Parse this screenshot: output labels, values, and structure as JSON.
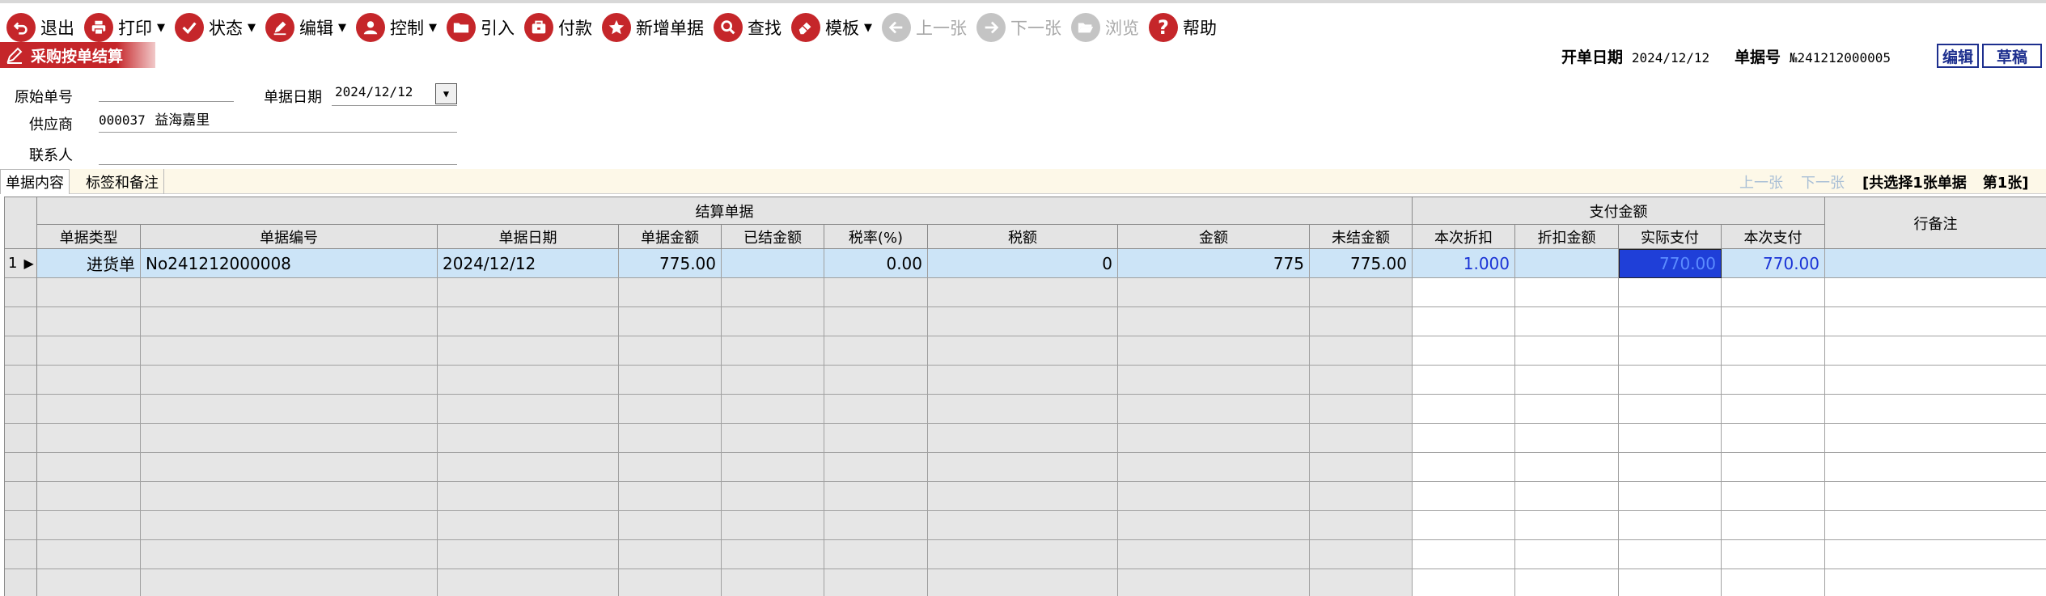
{
  "toolbar": {
    "items": [
      {
        "label": "退出",
        "icon": "exit-icon",
        "dropdown": false,
        "enabled": true
      },
      {
        "label": "打印",
        "icon": "printer-icon",
        "dropdown": true,
        "enabled": true
      },
      {
        "label": "状态",
        "icon": "check-icon",
        "dropdown": true,
        "enabled": true
      },
      {
        "label": "编辑",
        "icon": "pencil-icon",
        "dropdown": true,
        "enabled": true
      },
      {
        "label": "控制",
        "icon": "user-icon",
        "dropdown": true,
        "enabled": true
      },
      {
        "label": "引入",
        "icon": "folder-icon",
        "dropdown": false,
        "enabled": true
      },
      {
        "label": "付款",
        "icon": "briefcase-icon",
        "dropdown": false,
        "enabled": true
      },
      {
        "label": "新增单据",
        "icon": "star-icon",
        "dropdown": false,
        "enabled": true
      },
      {
        "label": "查找",
        "icon": "search-icon",
        "dropdown": false,
        "enabled": true
      },
      {
        "label": "模板",
        "icon": "eraser-icon",
        "dropdown": true,
        "enabled": true
      },
      {
        "label": "上一张",
        "icon": "arrow-left-icon",
        "dropdown": false,
        "enabled": false
      },
      {
        "label": "下一张",
        "icon": "arrow-right-icon",
        "dropdown": false,
        "enabled": false
      },
      {
        "label": "浏览",
        "icon": "folder-open-icon",
        "dropdown": false,
        "enabled": false
      },
      {
        "label": "帮助",
        "icon": "help-icon",
        "dropdown": false,
        "enabled": true
      }
    ]
  },
  "window": {
    "title": "采购按单结算"
  },
  "header": {
    "open_date_label": "开单日期",
    "open_date": "2024/12/12",
    "doc_no_label": "单据号",
    "doc_no": "№241212000005",
    "edit_label": "编辑",
    "draft_label": "草稿"
  },
  "form": {
    "orig_no_label": "原始单号",
    "orig_no": "",
    "doc_date_label": "单据日期",
    "doc_date": "2024/12/12",
    "supplier_label": "供应商",
    "supplier_code": "000037",
    "supplier_name": "益海嘉里",
    "contact_label": "联系人",
    "contact": ""
  },
  "tabs": {
    "content": "单据内容",
    "tags": "标签和备注"
  },
  "pager": {
    "prev": "上一张",
    "next": "下一张",
    "selected": "[共选择1张单据",
    "page": "第1张]"
  },
  "grid": {
    "group_settle": "结算单据",
    "group_pay": "支付金额",
    "col_type": "单据类型",
    "col_no": "单据编号",
    "col_date": "单据日期",
    "col_amount": "单据金额",
    "col_settled": "已结金额",
    "col_taxrate": "税率(%)",
    "col_tax": "税额",
    "col_money": "金额",
    "col_unsettled": "未结金额",
    "col_discount": "本次折扣",
    "col_disc_amount": "折扣金额",
    "col_actual": "实际支付",
    "col_this_pay": "本次支付",
    "col_remark": "行备注",
    "rows": [
      {
        "num": "1",
        "type": "进货单",
        "no": "No241212000008",
        "date": "2024/12/12",
        "amount": "775.00",
        "settled": "",
        "taxrate": "0.00",
        "tax": "0",
        "money": "775",
        "unsettled": "775.00",
        "discount": "1.000",
        "disc_amount": "",
        "actual": "770.00",
        "this_pay": "770.00",
        "remark": ""
      }
    ]
  },
  "colors": {
    "accent_red": "#c5262a",
    "row_selected": "#cce4f7",
    "cell_focus": "#1f3fd8",
    "blue_text": "#1a33d6"
  }
}
